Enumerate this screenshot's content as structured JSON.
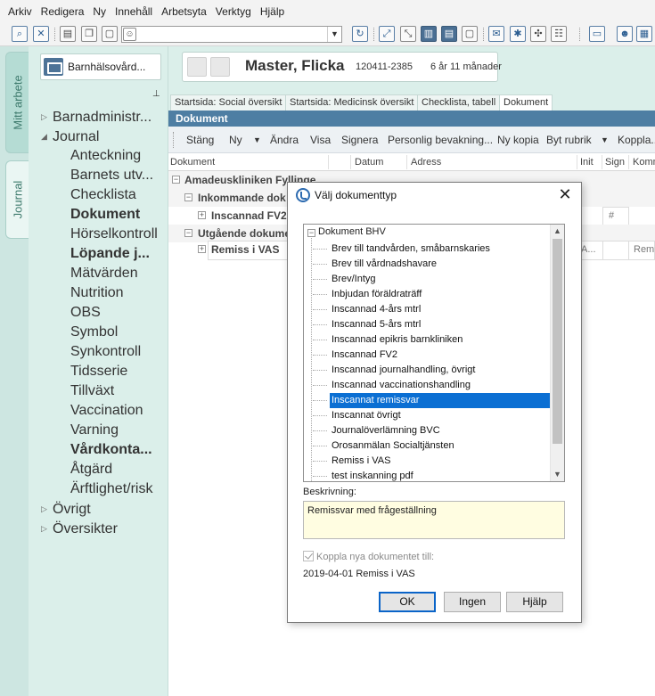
{
  "menu": [
    "Arkiv",
    "Redigera",
    "Ny",
    "Innehåll",
    "Arbetsyta",
    "Verktyg",
    "Hjälp"
  ],
  "toolbar": {
    "combo_value": "",
    "left_icons": [
      "search-icon",
      "close-doc-icon",
      "print-icon",
      "copy-icon",
      "blank-icon",
      "user-icon"
    ],
    "right_icons": [
      "refresh-icon",
      "expand-icon",
      "collapse-icon",
      "split-vertical-icon",
      "split-horizontal-icon",
      "window-icon",
      "mail-icon",
      "star-icon",
      "puzzle-icon",
      "config-icon",
      "folder-icon",
      "robot-icon",
      "calendar-icon"
    ]
  },
  "vertical_tabs": [
    {
      "label": "Mitt arbete"
    },
    {
      "label": "Journal"
    }
  ],
  "nav": {
    "org": "Barnhälsovård...",
    "items": [
      {
        "label": "Barnadministr...",
        "level": 0,
        "toggle": "▷",
        "bold": false
      },
      {
        "label": "Journal",
        "level": 0,
        "toggle": "◢",
        "bold": false
      },
      {
        "label": "Anteckning",
        "level": 1,
        "bold": false
      },
      {
        "label": "Barnets utv...",
        "level": 1,
        "bold": false
      },
      {
        "label": "Checklista",
        "level": 1,
        "bold": false
      },
      {
        "label": "Dokument",
        "level": 1,
        "bold": true
      },
      {
        "label": "Hörselkontroll",
        "level": 1,
        "bold": false
      },
      {
        "label": "Löpande j...",
        "level": 1,
        "bold": true
      },
      {
        "label": "Mätvärden",
        "level": 1,
        "bold": false
      },
      {
        "label": "Nutrition",
        "level": 1,
        "bold": false
      },
      {
        "label": "OBS",
        "level": 1,
        "bold": false
      },
      {
        "label": "Symbol",
        "level": 1,
        "bold": false
      },
      {
        "label": "Synkontroll",
        "level": 1,
        "bold": false
      },
      {
        "label": "Tidsserie",
        "level": 1,
        "bold": false
      },
      {
        "label": "Tillväxt",
        "level": 1,
        "bold": false
      },
      {
        "label": "Vaccination",
        "level": 1,
        "bold": false
      },
      {
        "label": "Varning",
        "level": 1,
        "bold": false
      },
      {
        "label": "Vårdkonta...",
        "level": 1,
        "bold": true
      },
      {
        "label": "Åtgärd",
        "level": 1,
        "bold": false
      },
      {
        "label": "Ärftlighet/risk",
        "level": 1,
        "bold": false
      },
      {
        "label": "Övrigt",
        "level": 0,
        "toggle": "▷",
        "bold": false
      },
      {
        "label": "Översikter",
        "level": 0,
        "toggle": "▷",
        "bold": false
      }
    ]
  },
  "patient": {
    "name": "Master, Flicka",
    "pnr": "120411-2385",
    "age": "6 år 11 månader"
  },
  "tabs": [
    {
      "label": "Startsida: Social översikt",
      "active": false
    },
    {
      "label": "Startsida: Medicinsk översikt",
      "active": false
    },
    {
      "label": "Checklista, tabell",
      "active": false
    },
    {
      "label": "Dokument",
      "active": true
    }
  ],
  "content_title": "Dokument",
  "actions": [
    "Stäng",
    "Ny",
    "▼",
    "Ändra",
    "Visa",
    "Signera",
    "Personlig bevakning...",
    "Ny kopia",
    "Byt rubrik",
    "▼",
    "Koppla..."
  ],
  "columns": [
    "Dokument",
    "Datum",
    "Adress",
    "Init",
    "Sign",
    "Komm"
  ],
  "grid": {
    "group1": "Amadeuskliniken Fyllinge",
    "sub1": "Inkommande dok",
    "row1": "Inscannad FV2",
    "row1_cell": "#",
    "sub2": "Utgående dokume",
    "row2": "Remiss i VAS",
    "row2_a": "A...",
    "row2_remi": "Remis"
  },
  "dialog": {
    "title": "Välj dokumenttyp",
    "close": "✕",
    "root": "Dokument BHV",
    "items": [
      "Brev till tandvården, småbarnskaries",
      "Brev till vårdnadshavare",
      "Brev/Intyg",
      "Inbjudan föräldraträff",
      "Inscannad 4-års mtrl",
      "Inscannad 5-års mtrl",
      "Inscannad epikris barnkliniken",
      "Inscannad FV2",
      "Inscannad journalhandling, övrigt",
      "Inscannad vaccinationshandling",
      "Inscannat remissvar",
      "Inscannat övrigt",
      "Journalöverlämning BVC",
      "Orosanmälan Socialtjänsten",
      "Remiss i VAS",
      "test inskanning pdf"
    ],
    "selected_index": 10,
    "desc_label": "Beskrivning:",
    "desc_value": "Remissvar med frågeställning",
    "link_label": "Koppla nya dokumentet till:",
    "link_value": "2019-04-01 Remiss i VAS",
    "buttons": {
      "ok": "OK",
      "none": "Ingen",
      "help": "Hjälp"
    }
  }
}
